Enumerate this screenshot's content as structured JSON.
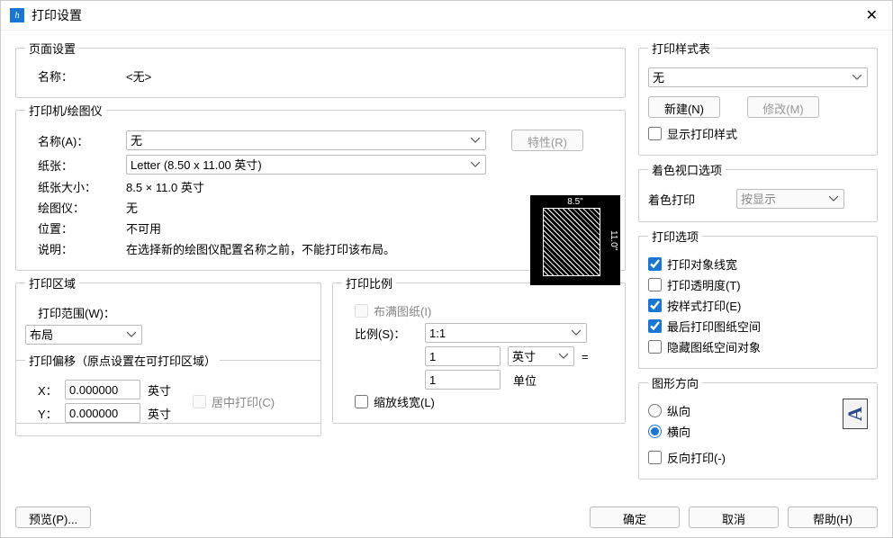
{
  "window": {
    "title": "打印设置"
  },
  "pageSetup": {
    "legend": "页面设置",
    "name_label": "名称：",
    "name_value": "<无>"
  },
  "printer": {
    "legend": "打印机/绘图仪",
    "name_label": "名称(A)：",
    "name_value": "无",
    "properties_btn": "特性(R)",
    "paper_label": "纸张：",
    "paper_value": "Letter (8.50 x 11.00 英寸)",
    "size_label": "纸张大小：",
    "size_value": "8.5 × 11.0  英寸",
    "plotter_label": "绘图仪：",
    "plotter_value": "无",
    "location_label": "位置：",
    "location_value": "不可用",
    "description_label": "说明：",
    "description_value": "在选择新的绘图仪配置名称之前，不能打印该布局。",
    "preview_w": "8.5\"",
    "preview_h": "11.0\""
  },
  "area": {
    "legend": "打印区域",
    "range_label": "打印范围(W)：",
    "range_value": "布局"
  },
  "offset": {
    "legend": "打印偏移（原点设置在可打印区域）",
    "x_label": "X：",
    "x_value": "0.000000",
    "y_label": "Y：",
    "y_value": "0.000000",
    "unit": "英寸",
    "center_label": "居中打印(C)"
  },
  "scale": {
    "legend": "打印比例",
    "fit_label": "布满图纸(I)",
    "ratio_label": "比例(S)：",
    "ratio_value": "1:1",
    "num1": "1",
    "unit1": "英寸",
    "equals": "=",
    "num2": "1",
    "unit2": "单位",
    "lineweight_label": "缩放线宽(L)"
  },
  "styleTable": {
    "legend": "打印样式表",
    "value": "无",
    "new_btn": "新建(N)",
    "modify_btn": "修改(M)",
    "display_styles": "显示打印样式"
  },
  "shade": {
    "legend": "着色视口选项",
    "label": "着色打印",
    "value": "按显示"
  },
  "options": {
    "legend": "打印选项",
    "lineweights": "打印对象线宽",
    "transparency": "打印透明度(T)",
    "by_style": "按样式打印(E)",
    "paperspace_last": "最后打印图纸空间",
    "hide_paperspace": "隐藏图纸空间对象"
  },
  "orientation": {
    "legend": "图形方向",
    "portrait": "纵向",
    "landscape": "横向",
    "upside_down": "反向打印(-)",
    "icon_letter": "A"
  },
  "footer": {
    "preview": "预览(P)...",
    "ok": "确定",
    "cancel": "取消",
    "help": "帮助(H)"
  }
}
